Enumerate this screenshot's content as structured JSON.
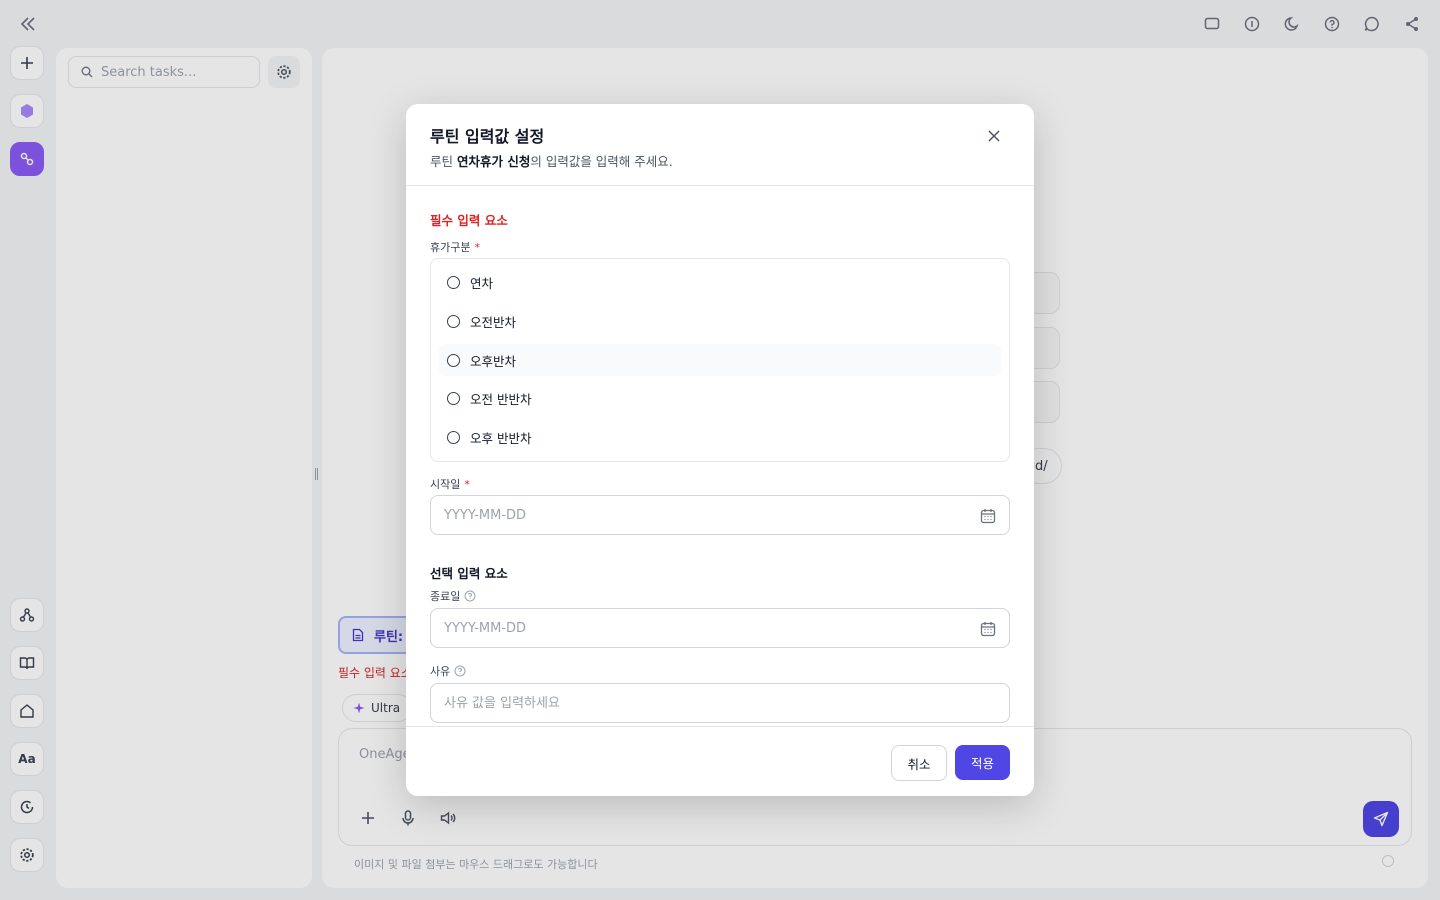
{
  "app": {
    "topbar_icons": [
      "window-icon",
      "info-icon",
      "moon-icon",
      "help-icon",
      "chat-icon",
      "share-icon"
    ],
    "tasks": {
      "search_placeholder": "Search tasks..."
    },
    "composer": {
      "routine_chip_label": "루틴:",
      "required_hint": "필수 입력 요소",
      "mode_label": "Ultra",
      "placeholder": "OneAge",
      "drag_hint": "이미지 및 파일 첨부는 마우스 드래그로도 가능합니다"
    },
    "ghost_chip_label": "d/"
  },
  "modal": {
    "title": "루틴 입력값 설정",
    "subtitle_prefix": "루틴 ",
    "subtitle_routine_name": "연차휴가 신청",
    "subtitle_suffix": "의 입력값을 입력해 주세요.",
    "required_section": "필수 입력 요소",
    "optional_section": "선택 입력 요소",
    "fields": {
      "leave_type": {
        "label": "휴가구분",
        "required_mark": "*",
        "options": [
          "연차",
          "오전반차",
          "오후반차",
          "오전 반반차",
          "오후 반반차"
        ]
      },
      "start_date": {
        "label": "시작일",
        "required_mark": "*",
        "placeholder": "YYYY-MM-DD"
      },
      "end_date": {
        "label": "종료일",
        "placeholder": "YYYY-MM-DD"
      },
      "reason": {
        "label": "사유",
        "placeholder": "사유 값을 입력하세요"
      }
    },
    "buttons": {
      "cancel": "취소",
      "apply": "적용"
    }
  },
  "colors": {
    "accent": "#4f46e5",
    "required": "#dc2626",
    "rail_active": "#8b5cf6"
  }
}
